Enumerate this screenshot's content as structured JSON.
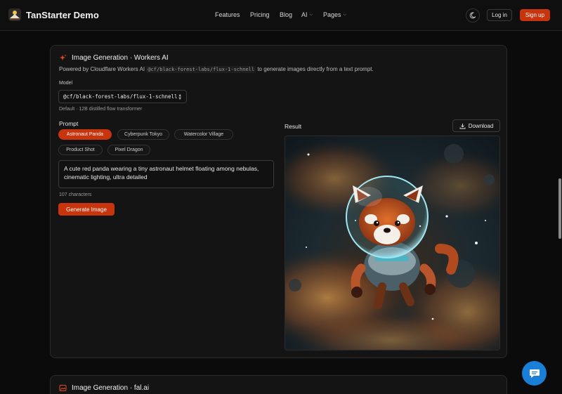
{
  "header": {
    "brand": "TanStarter Demo",
    "nav": [
      {
        "label": "Features"
      },
      {
        "label": "Pricing"
      },
      {
        "label": "Blog"
      },
      {
        "label": "AI"
      },
      {
        "label": "Pages"
      }
    ],
    "login": "Log in",
    "signup": "Sign up"
  },
  "card": {
    "title": "Image Generation · Workers AI",
    "desc_prefix": "Powered by Cloudflare Workers AI",
    "desc_code": "@cf/black-forest-labs/flux-1-schnell",
    "desc_suffix": "to generate images directly from a text prompt.",
    "model_label": "Model",
    "model_value": "@cf/black-forest-labs/flux-1-schnell",
    "model_note": "Default · 12B distilled flow transformer",
    "prompt_label": "Prompt",
    "chips": [
      {
        "label": "Astronaut Panda",
        "active": true
      },
      {
        "label": "Cyberpunk Tokyo",
        "active": false
      },
      {
        "label": "Watercolor Village",
        "active": false
      },
      {
        "label": "Product Shot",
        "active": false
      },
      {
        "label": "Pixel Dragon",
        "active": false
      }
    ],
    "prompt_text": "A cute red panda wearing a tiny astronaut helmet floating among nebulas, cinematic lighting, ultra detailed",
    "char_count": "107 characters",
    "generate": "Generate Image",
    "result_label": "Result",
    "download": "Download"
  },
  "card2": {
    "title": "Image Generation · fal.ai"
  },
  "colors": {
    "accent": "#c7340d",
    "chat": "#1a7fd6"
  }
}
